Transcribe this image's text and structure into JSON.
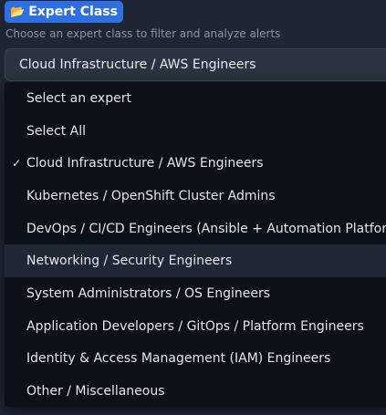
{
  "header": {
    "badge_icon": "open-folder-icon",
    "badge_icon_glyph": "📂",
    "badge_label": "Expert Class",
    "hint": "Choose an expert class to filter and analyze alerts"
  },
  "select": {
    "value": "Cloud Infrastructure / AWS Engineers",
    "options": [
      {
        "label": "Select an expert",
        "checked": false,
        "highlighted": false
      },
      {
        "label": "Select All",
        "checked": false,
        "highlighted": false
      },
      {
        "label": "Cloud Infrastructure / AWS Engineers",
        "checked": true,
        "highlighted": false
      },
      {
        "label": "Kubernetes / OpenShift Cluster Admins",
        "checked": false,
        "highlighted": false
      },
      {
        "label": "DevOps / CI/CD Engineers (Ansible + Automation Platform)",
        "checked": false,
        "highlighted": false
      },
      {
        "label": "Networking / Security Engineers",
        "checked": false,
        "highlighted": true
      },
      {
        "label": "System Administrators / OS Engineers",
        "checked": false,
        "highlighted": false
      },
      {
        "label": "Application Developers / GitOps / Platform Engineers",
        "checked": false,
        "highlighted": false
      },
      {
        "label": "Identity & Access Management (IAM) Engineers",
        "checked": false,
        "highlighted": false
      },
      {
        "label": "Other / Miscellaneous",
        "checked": false,
        "highlighted": false
      }
    ]
  },
  "colors": {
    "background": "#1f2633",
    "accent": "#2f6fe4",
    "menu_bg": "#0c1019",
    "highlight_bg": "#1f2634"
  }
}
